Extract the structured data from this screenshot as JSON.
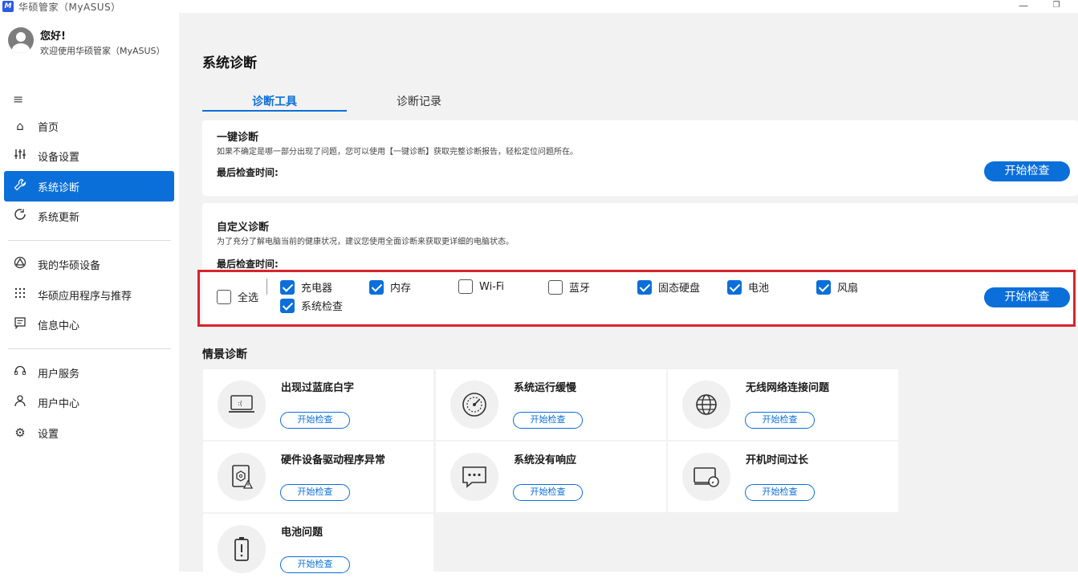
{
  "window": {
    "title": "华硕管家（MyASUS）",
    "logo": "M"
  },
  "sidebar": {
    "greeting": "您好!",
    "welcome": "欢迎使用华硕管家（MyASUS）",
    "items": [
      {
        "label": "首页",
        "icon": "home-icon"
      },
      {
        "label": "设备设置",
        "icon": "sliders-icon"
      },
      {
        "label": "系统诊断",
        "icon": "wrench-icon",
        "active": true
      },
      {
        "label": "系统更新",
        "icon": "update-icon"
      },
      {
        "label": "我的华硕设备",
        "icon": "device-icon"
      },
      {
        "label": "华硕应用程序与推荐",
        "icon": "apps-grid-icon"
      },
      {
        "label": "信息中心",
        "icon": "message-icon"
      },
      {
        "label": "用户服务",
        "icon": "headset-icon"
      },
      {
        "label": "用户中心",
        "icon": "user-icon"
      },
      {
        "label": "设置",
        "icon": "gear-icon"
      }
    ]
  },
  "main": {
    "page_title": "系统诊断",
    "tabs": [
      {
        "label": "诊断工具",
        "active": true
      },
      {
        "label": "诊断记录"
      }
    ],
    "one_click": {
      "title": "一键诊断",
      "desc": "如果不确定是哪一部分出现了问题，您可以使用【一键诊断】获取完整诊断报告，轻松定位问题所在。",
      "last_check": "最后检查时间:",
      "button": "开始检查"
    },
    "custom": {
      "title": "自定义诊断",
      "desc": "为了充分了解电脑当前的健康状况，建议您使用全面诊断来获取更详细的电脑状态。",
      "last_check": "最后检查时间:",
      "select_all": "全选",
      "items": [
        {
          "label": "充电器",
          "checked": true
        },
        {
          "label": "内存",
          "checked": true
        },
        {
          "label": "Wi-Fi",
          "checked": false
        },
        {
          "label": "蓝牙",
          "checked": false
        },
        {
          "label": "固态硬盘",
          "checked": true
        },
        {
          "label": "电池",
          "checked": true
        },
        {
          "label": "风扇",
          "checked": true
        },
        {
          "label": "系统检查",
          "checked": true
        }
      ],
      "button": "开始检查"
    },
    "scenario": {
      "title": "情景诊断",
      "items": [
        {
          "title": "出现过蓝底白字",
          "button": "开始检查",
          "icon": "bluescreen-laptop-icon",
          "glyph": ":("
        },
        {
          "title": "系统运行缓慢",
          "button": "开始检查",
          "icon": "speedometer-icon"
        },
        {
          "title": "无线网络连接问题",
          "button": "开始检查",
          "icon": "globe-icon"
        },
        {
          "title": "硬件设备驱动程序异常",
          "button": "开始检查",
          "icon": "driver-warning-icon"
        },
        {
          "title": "系统没有响应",
          "button": "开始检查",
          "icon": "chat-dots-icon"
        },
        {
          "title": "开机时间过长",
          "button": "开始检查",
          "icon": "boot-time-icon"
        },
        {
          "title": "电池问题",
          "button": "开始检查",
          "icon": "battery-alert-icon"
        }
      ]
    }
  }
}
